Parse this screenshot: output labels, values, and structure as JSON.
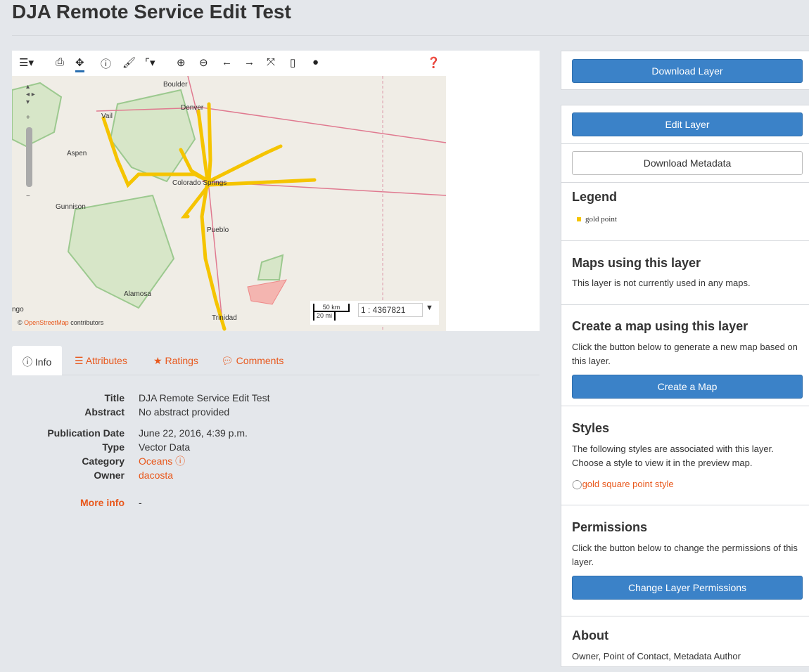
{
  "page_title": "DJA Remote Service Edit Test",
  "toolbar": {
    "icons": [
      "menu-icon",
      "print-icon",
      "pan-icon",
      "info-icon",
      "paintbrush-icon",
      "measure-icon",
      "zoom-in-icon",
      "zoom-out-icon",
      "back-arrow-icon",
      "forward-arrow-icon",
      "fullscreen-icon",
      "calendar-icon",
      "globe-icon",
      "help-icon"
    ]
  },
  "map": {
    "places": [
      "Boulder",
      "Denver",
      "Vail",
      "Aspen",
      "Colorado Springs",
      "Gunnison",
      "Pueblo",
      "Alamosa",
      "Trinidad",
      "ngo"
    ],
    "scale_km": "50 km",
    "scale_mi": "20 mi",
    "scale_ratio": "1 : 4367821",
    "attribution_prefix": "©",
    "attribution_link": "OpenStreetMap",
    "attribution_suffix": "contributors",
    "layer_color": "#f5c400"
  },
  "tabs": [
    {
      "label": "Info",
      "icon": "info-icon"
    },
    {
      "label": "Attributes",
      "icon": "list-icon"
    },
    {
      "label": "Ratings",
      "icon": "star-icon"
    },
    {
      "label": "Comments",
      "icon": "comment-icon"
    }
  ],
  "info": {
    "title_label": "Title",
    "title": "DJA Remote Service Edit Test",
    "abstract_label": "Abstract",
    "abstract": "No abstract provided",
    "date_label": "Publication Date",
    "date": "June 22, 2016, 4:39 p.m.",
    "type_label": "Type",
    "type": "Vector Data",
    "category_label": "Category",
    "category": "Oceans",
    "owner_label": "Owner",
    "owner": "dacosta",
    "more_label": "More info",
    "more": "-"
  },
  "sidebar": {
    "download_layer": "Download Layer",
    "edit_layer": "Edit Layer",
    "download_metadata": "Download Metadata",
    "legend_title": "Legend",
    "legend_item": "gold point",
    "maps_title": "Maps using this layer",
    "maps_text": "This layer is not currently used in any maps.",
    "create_title": "Create a map using this layer",
    "create_text": "Click the button below to generate a new map based on this layer.",
    "create_button": "Create a Map",
    "styles_title": "Styles",
    "styles_text": "The following styles are associated with this layer. Choose a style to view it in the preview map.",
    "style_option": "gold square point style",
    "perm_title": "Permissions",
    "perm_text": "Click the button below to change the permissions of this layer.",
    "perm_button": "Change Layer Permissions",
    "about_title": "About",
    "about_text": "Owner, Point of Contact, Metadata Author"
  },
  "colors": {
    "accent": "#3b82c8",
    "link": "#e8581c"
  }
}
